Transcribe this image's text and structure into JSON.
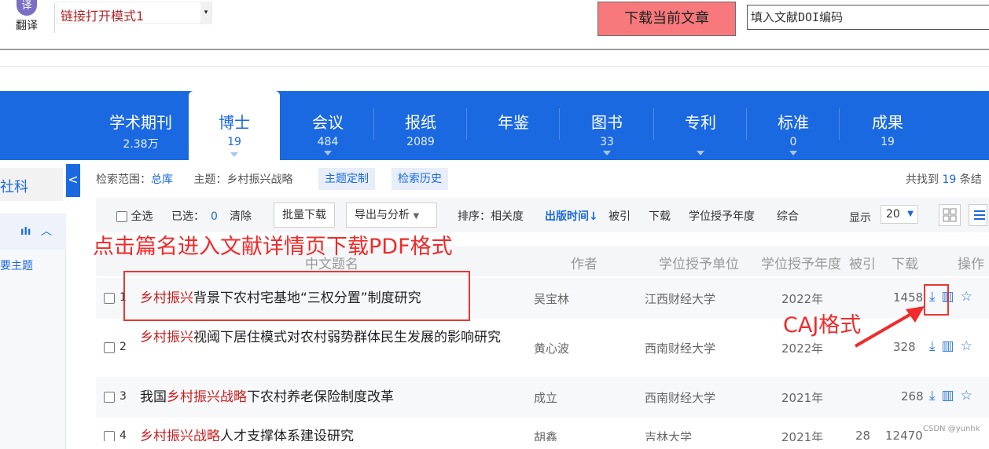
{
  "toolbar": {
    "translate_label": "翻译",
    "translate_icon": "译",
    "mode_select": "链接打开模式1",
    "download_current": "下载当前文章",
    "doi_placeholder": "填入文献DOI编码"
  },
  "tabs": [
    {
      "title": "学术期刊",
      "count": "2.38万"
    },
    {
      "title": "博士",
      "count": "19"
    },
    {
      "title": "会议",
      "count": "484"
    },
    {
      "title": "报纸",
      "count": "2089"
    },
    {
      "title": "年鉴",
      "count": ""
    },
    {
      "title": "图书",
      "count": "33"
    },
    {
      "title": "专利",
      "count": ""
    },
    {
      "title": "标准",
      "count": "0"
    },
    {
      "title": "成果",
      "count": "19"
    }
  ],
  "sidebar": {
    "card_label": "社科",
    "collapse_icon": "<",
    "section_label": "要主题"
  },
  "scope": {
    "range_label": "检索范围：",
    "range_value": "总库",
    "topic_label": "主题：",
    "topic_value": "乡村振兴战略",
    "custom_topic": "主题定制",
    "search_history": "检索历史",
    "found_prefix": "共找到",
    "found_count": "19",
    "found_suffix": "条结"
  },
  "controls": {
    "select_all": "全选",
    "selected_label": "已选：",
    "selected_count": "0",
    "clear": "清除",
    "batch_download": "批量下载",
    "export": "导出与分析",
    "sort_label": "排序：",
    "sort_options": [
      "相关度",
      "出版时间",
      "被引",
      "下载",
      "学位授予年度",
      "综合"
    ],
    "show_label": "显示",
    "page_size": "20"
  },
  "annotations": {
    "main": "点击篇名进入文献详情页下载PDF格式",
    "caj": "CAJ格式"
  },
  "table": {
    "headers": [
      "中文题名",
      "作者",
      "学位授予单位",
      "学位授予年度",
      "被引",
      "下载",
      "操作"
    ],
    "rows": [
      {
        "num": "1",
        "title_hl": "乡村振兴",
        "title_rest": "背景下农村宅基地“三权分置”制度研究",
        "author": "吴宝林",
        "unit": "江西财经大学",
        "year": "2022年",
        "cited": "",
        "downloads": "1458"
      },
      {
        "num": "2",
        "title_hl": "乡村振兴",
        "title_rest": "视阈下居住模式对农村弱势群体民生发展的影响研究",
        "author": "黄心波",
        "unit": "西南财经大学",
        "year": "2022年",
        "cited": "",
        "downloads": "328"
      },
      {
        "num": "3",
        "title_pre": "我国",
        "title_hl": "乡村振兴战略",
        "title_rest": "下农村养老保险制度改革",
        "author": "成立",
        "unit": "西南财经大学",
        "year": "2021年",
        "cited": "",
        "downloads": "268"
      },
      {
        "num": "4",
        "title_hl": "乡村振兴战略",
        "title_rest": "人才支撑体系建设研究",
        "author": "胡鑫",
        "unit": "吉林大学",
        "year": "2021年",
        "cited": "28",
        "downloads": "12470"
      }
    ]
  },
  "watermark": "CSDN @yunhk"
}
